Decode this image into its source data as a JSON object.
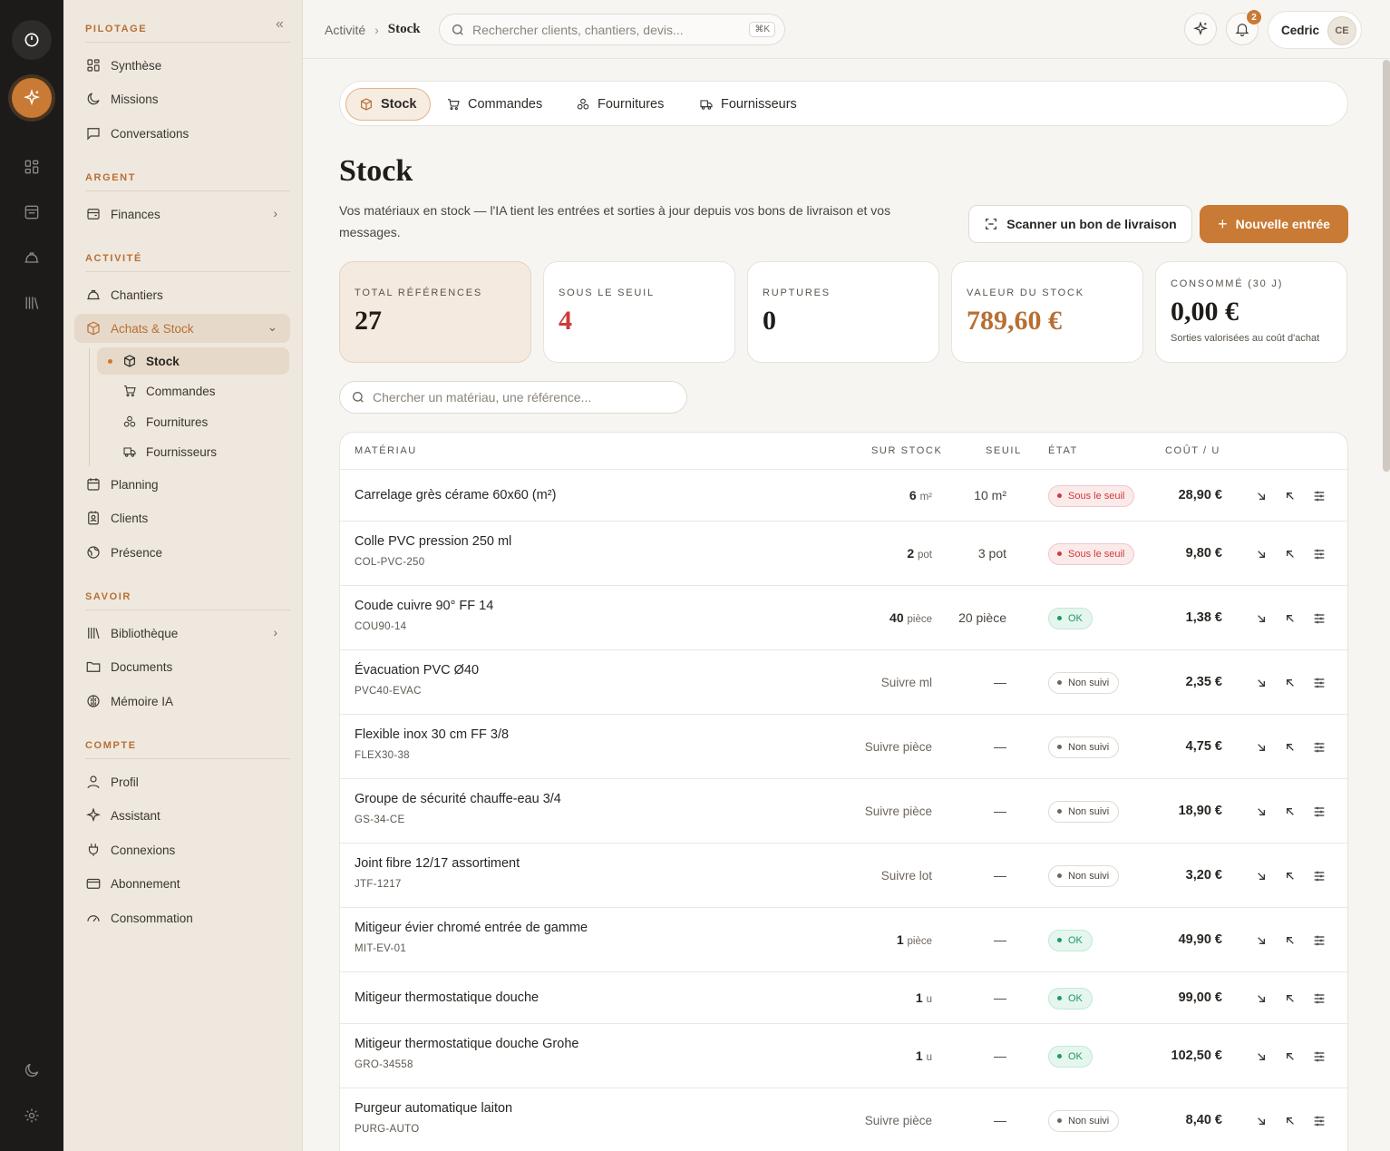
{
  "rail": {
    "icons": [
      "power-icon",
      "sparkle-icon",
      "grid-icon",
      "inbox-icon",
      "hardhat-icon",
      "library-icon",
      "moon-icon",
      "gear-icon"
    ]
  },
  "sidebar": {
    "sections": {
      "pilotage": "PILOTAGE",
      "argent": "ARGENT",
      "activite": "ACTIVITÉ",
      "savoir": "SAVOIR",
      "compte": "COMPTE"
    },
    "items": {
      "synthese": "Synthèse",
      "missions": "Missions",
      "conversations": "Conversations",
      "finances": "Finances",
      "chantiers": "Chantiers",
      "achats": "Achats & Stock",
      "planning": "Planning",
      "clients": "Clients",
      "presence": "Présence",
      "bibliotheque": "Bibliothèque",
      "documents": "Documents",
      "memoire": "Mémoire IA",
      "profil": "Profil",
      "assistant": "Assistant",
      "connexions": "Connexions",
      "abonnement": "Abonnement",
      "consommation": "Consommation"
    },
    "sub": {
      "stock": "Stock",
      "commandes": "Commandes",
      "fournitures": "Fournitures",
      "fournisseurs": "Fournisseurs"
    }
  },
  "topbar": {
    "breadcrumb": [
      "Activité",
      "Stock"
    ],
    "search_placeholder": "Rechercher clients, chantiers, devis...",
    "shortcut": "⌘K",
    "notif_count": "2",
    "user_name": "Cedric",
    "user_initials": "CE"
  },
  "tabs": [
    "Stock",
    "Commandes",
    "Fournitures",
    "Fournisseurs"
  ],
  "page": {
    "title": "Stock",
    "description": "Vos matériaux en stock — l'IA tient les entrées et sorties à jour depuis vos bons de livraison et vos messages.",
    "scan_button": "Scanner un bon de livraison",
    "new_button": "Nouvelle entrée",
    "filter_placeholder": "Chercher un matériau, une référence..."
  },
  "stats": [
    {
      "label": "TOTAL RÉFÉRENCES",
      "value": "27"
    },
    {
      "label": "SOUS LE SEUIL",
      "value": "4"
    },
    {
      "label": "RUPTURES",
      "value": "0"
    },
    {
      "label": "VALEUR DU STOCK",
      "value": "789,60 €"
    },
    {
      "label": "CONSOMMÉ (30 J)",
      "value": "0,00 €",
      "note": "Sorties valorisées au coût d'achat"
    }
  ],
  "table": {
    "headers": [
      "MATÉRIAU",
      "SUR STOCK",
      "SEUIL",
      "ÉTAT",
      "COÛT / U"
    ],
    "rows": [
      {
        "name": "Carrelage grès cérame 60x60 (m²)",
        "ref": "",
        "qty": "6",
        "unit": "m²",
        "seuil": "10 m²",
        "etat": "Sous le seuil",
        "cost": "28,90 €"
      },
      {
        "name": "Colle PVC pression 250 ml",
        "ref": "COL-PVC-250",
        "qty": "2",
        "unit": "pot",
        "seuil": "3 pot",
        "etat": "Sous le seuil",
        "cost": "9,80 €"
      },
      {
        "name": "Coude cuivre 90° FF 14",
        "ref": "COU90-14",
        "qty": "40",
        "unit": "pièce",
        "seuil": "20 pièce",
        "etat": "OK",
        "cost": "1,38 €"
      },
      {
        "name": "Évacuation PVC Ø40",
        "ref": "PVC40-EVAC",
        "track": "Suivre ml",
        "seuil": "—",
        "etat": "Non suivi",
        "cost": "2,35 €"
      },
      {
        "name": "Flexible inox 30 cm FF 3/8",
        "ref": "FLEX30-38",
        "track": "Suivre pièce",
        "seuil": "—",
        "etat": "Non suivi",
        "cost": "4,75 €"
      },
      {
        "name": "Groupe de sécurité chauffe-eau 3/4",
        "ref": "GS-34-CE",
        "track": "Suivre pièce",
        "seuil": "—",
        "etat": "Non suivi",
        "cost": "18,90 €"
      },
      {
        "name": "Joint fibre 12/17 assortiment",
        "ref": "JTF-1217",
        "track": "Suivre lot",
        "seuil": "—",
        "etat": "Non suivi",
        "cost": "3,20 €"
      },
      {
        "name": "Mitigeur évier chromé entrée de gamme",
        "ref": "MIT-EV-01",
        "qty": "1",
        "unit": "pièce",
        "seuil": "—",
        "etat": "OK",
        "cost": "49,90 €"
      },
      {
        "name": "Mitigeur thermostatique douche",
        "ref": "",
        "qty": "1",
        "unit": "u",
        "seuil": "—",
        "etat": "OK",
        "cost": "99,00 €"
      },
      {
        "name": "Mitigeur thermostatique douche Grohe",
        "ref": "GRO-34558",
        "qty": "1",
        "unit": "u",
        "seuil": "—",
        "etat": "OK",
        "cost": "102,50 €"
      },
      {
        "name": "Purgeur automatique laiton",
        "ref": "PURG-AUTO",
        "track": "Suivre pièce",
        "seuil": "—",
        "etat": "Non suivi",
        "cost": "8,40 €"
      }
    ]
  },
  "colors": {
    "accent": "#c97a34",
    "danger": "#cf3b3b",
    "ok": "#1f9a63",
    "sidebar": "#efe8df",
    "rail": "#1c1b1a"
  }
}
